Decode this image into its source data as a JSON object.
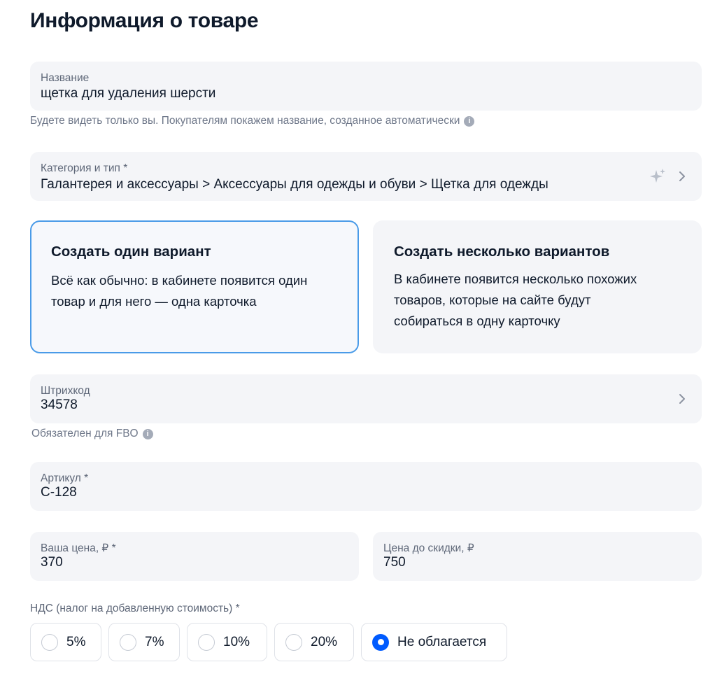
{
  "page": {
    "title": "Информация о товаре"
  },
  "name_field": {
    "label": "Название",
    "value": "щетка для удаления шерсти",
    "hint": "Будете видеть только вы. Покупателям покажем название, созданное автоматически"
  },
  "category_field": {
    "label": "Категория и тип *",
    "value": "Галантерея и аксессуары > Аксессуары для одежды и обуви > Щетка для одежды",
    "icon": "sparkle-icon"
  },
  "variants": [
    {
      "title": "Создать один вариант",
      "desc_lines": [
        "Всё как обычно: в кабинете появится один",
        "товар и для него — одна карточка"
      ],
      "selected": true
    },
    {
      "title": "Создать несколько вариантов",
      "desc_lines": [
        "В кабинете появится несколько похожих",
        "товаров, которые на сайте будут",
        "собираться в одну карточку"
      ],
      "selected": false
    }
  ],
  "barcode_field": {
    "label": "Штрихкод",
    "value": "34578",
    "hint": "Обязателен для FBO"
  },
  "article_field": {
    "label": "Артикул *",
    "value": "С-128"
  },
  "price_field": {
    "label": "Ваша цена, ₽ *",
    "value": "370"
  },
  "old_price_field": {
    "label": "Цена до скидки, ₽",
    "value": "750"
  },
  "vat": {
    "label": "НДС (налог на добавленную стоимость) *",
    "options": [
      "5%",
      "7%",
      "10%",
      "20%",
      "Не облагается"
    ],
    "selected_index": 4
  },
  "colors": {
    "accent": "#005bff",
    "selected_border": "#4a9be8",
    "field_bg": "#f4f5f8"
  }
}
